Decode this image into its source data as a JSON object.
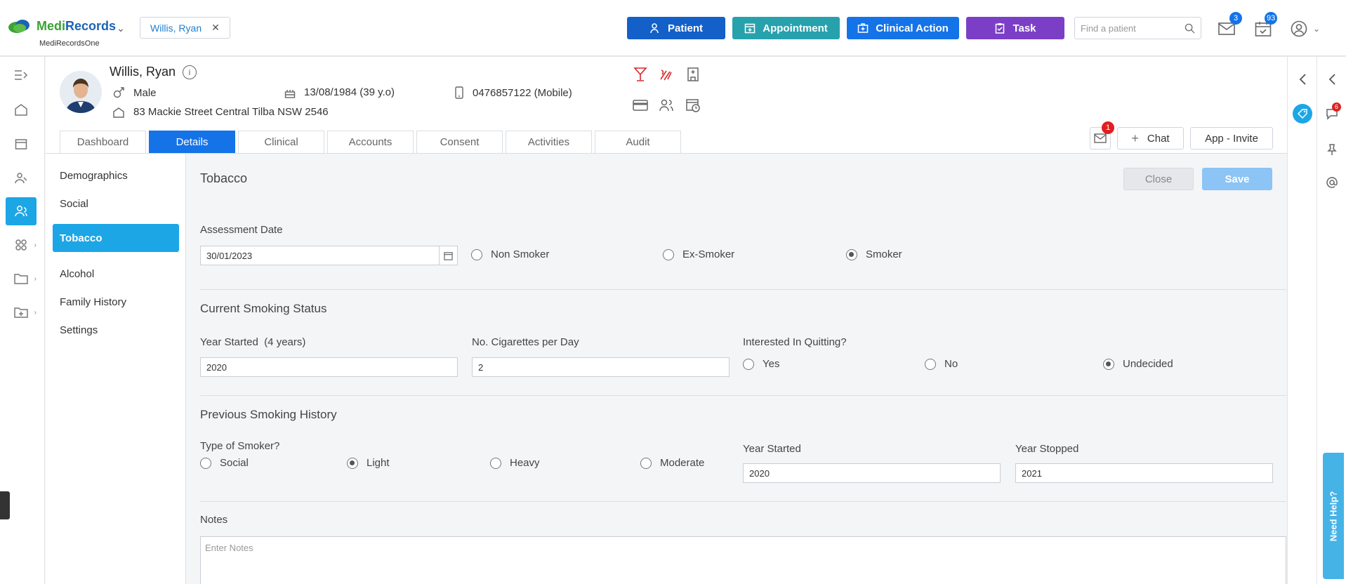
{
  "app": {
    "brand_medi": "Medi",
    "brand_records": "Records",
    "org_name": "MediRecordsOne"
  },
  "open_patient_tab": {
    "label": "Willis, Ryan"
  },
  "top_actions": {
    "patient": "Patient",
    "appointment": "Appointment",
    "clinical_action": "Clinical Action",
    "task": "Task"
  },
  "search": {
    "placeholder": "Find a patient"
  },
  "badges": {
    "messages": "3",
    "tasks": "93"
  },
  "patient": {
    "name": "Willis, Ryan",
    "sex": "Male",
    "dob": "13/08/1984 (39 y.o)",
    "phone": "0476857122 (Mobile)",
    "address": "83 Mackie Street Central Tilba NSW 2546"
  },
  "tabs": [
    "Dashboard",
    "Details",
    "Clinical",
    "Accounts",
    "Consent",
    "Activities",
    "Audit"
  ],
  "header_actions": {
    "mail_badge": "1",
    "chat": "Chat",
    "app_invite": "App - Invite"
  },
  "subnav": [
    "Demographics",
    "Social",
    "Tobacco",
    "Alcohol",
    "Family History",
    "Settings"
  ],
  "form": {
    "title": "Tobacco",
    "close": "Close",
    "save": "Save",
    "assessment_date_label": "Assessment Date",
    "assessment_date": "30/01/2023",
    "smoker_status": {
      "options": [
        "Non Smoker",
        "Ex-Smoker",
        "Smoker"
      ],
      "selected": "Smoker"
    },
    "current_title": "Current Smoking Status",
    "year_started_label": "Year Started",
    "year_started_note": "(4 years)",
    "year_started": "2020",
    "cigs_label": "No. Cigarettes per Day",
    "cigs": "2",
    "quitting_label": "Interested In Quitting?",
    "quitting": {
      "options": [
        "Yes",
        "No",
        "Undecided"
      ],
      "selected": "Undecided"
    },
    "previous_title": "Previous Smoking History",
    "type_label": "Type of Smoker?",
    "type": {
      "options": [
        "Social",
        "Light",
        "Heavy",
        "Moderate"
      ],
      "selected": "Light"
    },
    "prev_year_started_label": "Year Started",
    "prev_year_started": "2020",
    "prev_year_stopped_label": "Year Stopped",
    "prev_year_stopped": "2021",
    "notes_label": "Notes",
    "notes_placeholder": "Enter Notes"
  },
  "right_badge": "6",
  "need_help": "Need Help?",
  "colors": {
    "primary": "#1573e8",
    "teal": "#27a2ad",
    "purple": "#7b3fc7",
    "sidebar_active": "#1ca6e6",
    "save_disabled": "#8cc4f5"
  }
}
